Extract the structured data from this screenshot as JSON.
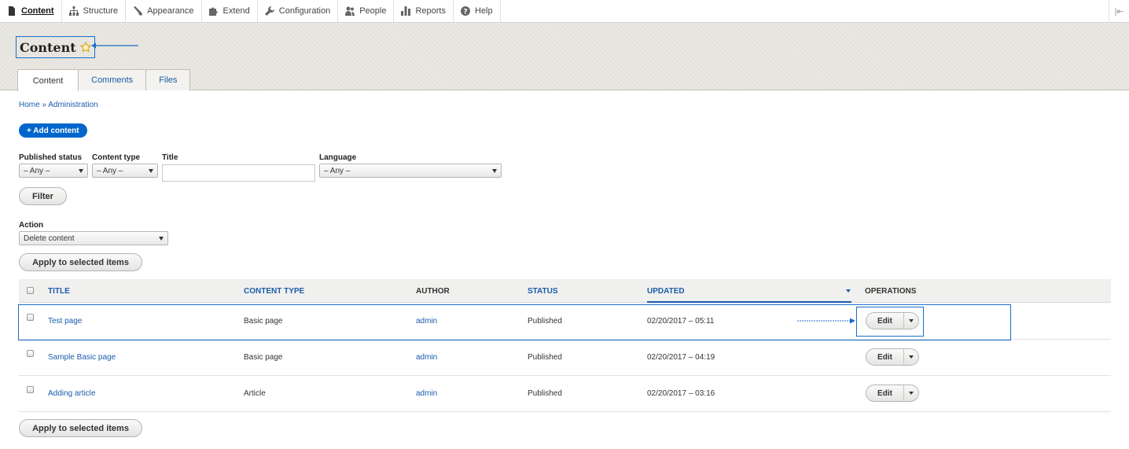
{
  "toolbar": {
    "items": [
      {
        "label": "Content",
        "icon": "file-icon",
        "active": true
      },
      {
        "label": "Structure",
        "icon": "sitemap-icon"
      },
      {
        "label": "Appearance",
        "icon": "brush-icon"
      },
      {
        "label": "Extend",
        "icon": "puzzle-icon"
      },
      {
        "label": "Configuration",
        "icon": "wrench-icon"
      },
      {
        "label": "People",
        "icon": "people-icon"
      },
      {
        "label": "Reports",
        "icon": "bar-chart-icon"
      },
      {
        "label": "Help",
        "icon": "help-icon"
      }
    ],
    "collapse_glyph": "|⇤"
  },
  "page": {
    "title": "Content",
    "tabs": [
      "Content",
      "Comments",
      "Files"
    ]
  },
  "breadcrumb": "Home » Administration",
  "add_content_label": "+ Add content",
  "filters": {
    "published_status": {
      "label": "Published status",
      "value": "– Any –"
    },
    "content_type": {
      "label": "Content type",
      "value": "– Any –"
    },
    "title": {
      "label": "Title",
      "value": ""
    },
    "language": {
      "label": "Language",
      "value": "– Any –"
    },
    "filter_button": "Filter"
  },
  "bulk": {
    "action_label": "Action",
    "action_value": "Delete content",
    "apply_label": "Apply to selected items"
  },
  "table": {
    "headers": {
      "title": "Title",
      "content_type": "Content type",
      "author": "Author",
      "status": "Status",
      "updated": "Updated",
      "operations": "Operations"
    },
    "rows": [
      {
        "title": "Test page",
        "type": "Basic page",
        "author": "admin",
        "status": "Published",
        "updated": "02/20/2017 – 05:11",
        "op": "Edit"
      },
      {
        "title": "Sample Basic page",
        "type": "Basic page",
        "author": "admin",
        "status": "Published",
        "updated": "02/20/2017 – 04:19",
        "op": "Edit"
      },
      {
        "title": "Adding article",
        "type": "Article",
        "author": "admin",
        "status": "Published",
        "updated": "02/20/2017 – 03:16",
        "op": "Edit"
      }
    ]
  },
  "colors": {
    "link": "#1a5cab",
    "primary_button": "#0066cc",
    "annotation": "#1a6ec8"
  }
}
